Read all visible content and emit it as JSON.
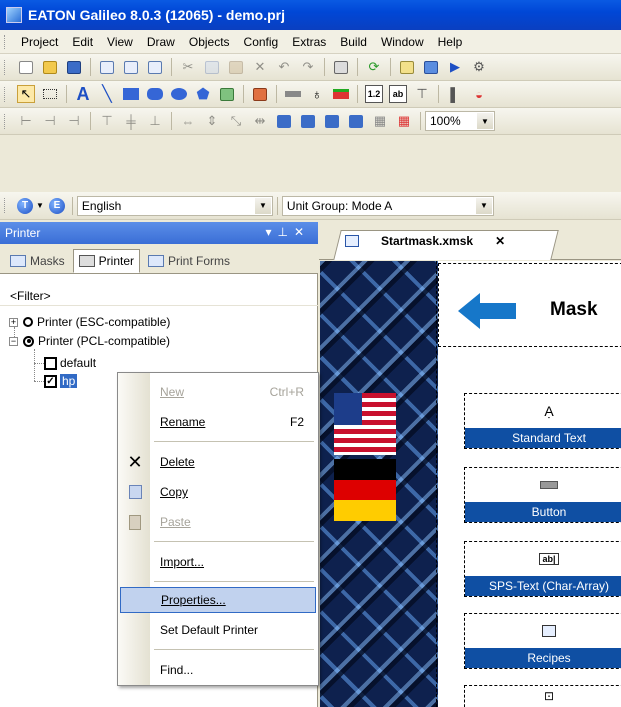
{
  "window": {
    "title": "EATON Galileo 8.0.3 (12065) - demo.prj"
  },
  "menubar": {
    "items": [
      "Project",
      "Edit",
      "View",
      "Draw",
      "Objects",
      "Config",
      "Extras",
      "Build",
      "Window",
      "Help"
    ]
  },
  "toolbar4": {
    "zoom": "100%"
  },
  "langbar": {
    "language": "English",
    "unit_group": "Unit Group: Mode A"
  },
  "panel": {
    "title": "Printer",
    "tabs": [
      "Masks",
      "Printer",
      "Print Forms"
    ],
    "filter": "<Filter>",
    "tree": {
      "esc": "Printer (ESC-compatible)",
      "pcl": "Printer (PCL-compatible)",
      "default": "default",
      "hp": "hp"
    }
  },
  "context_menu": {
    "new": {
      "label": "New",
      "shortcut": "Ctrl+R"
    },
    "rename": {
      "label": "Rename",
      "shortcut": "F2"
    },
    "delete": {
      "label": "Delete"
    },
    "copy": {
      "label": "Copy"
    },
    "paste": {
      "label": "Paste"
    },
    "import": {
      "label": "Import..."
    },
    "properties": {
      "label": "Properties..."
    },
    "set_default": {
      "label": "Set Default Printer"
    },
    "find": {
      "label": "Find..."
    }
  },
  "editor": {
    "tab": "Startmask.xmsk",
    "mask_title": "Mask",
    "widgets": [
      "Standard Text",
      "Button",
      "SPS-Text (Char-Array)",
      "Recipes"
    ]
  }
}
